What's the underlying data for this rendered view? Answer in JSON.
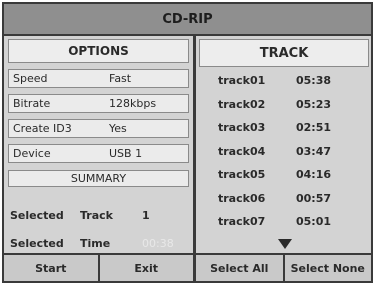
{
  "title": "CD-RIP",
  "options": {
    "header": "OPTIONS",
    "items": [
      {
        "label": "Speed",
        "value": "Fast"
      },
      {
        "label": "Bitrate",
        "value": "128kbps"
      },
      {
        "label": "Create ID3",
        "value": "Yes"
      },
      {
        "label": "Device",
        "value": "USB 1"
      }
    ]
  },
  "summary": {
    "header": "SUMMARY",
    "rows": [
      {
        "label": "Selected",
        "field": "Track",
        "value": "1"
      },
      {
        "label": "Selected",
        "field": "Time",
        "value": "00:38"
      }
    ]
  },
  "track_panel": {
    "header": "TRACK",
    "tracks": [
      {
        "name": "track01",
        "time": "05:38"
      },
      {
        "name": "track02",
        "time": "05:23"
      },
      {
        "name": "track03",
        "time": "02:51"
      },
      {
        "name": "track04",
        "time": "03:47"
      },
      {
        "name": "track05",
        "time": "04:16"
      },
      {
        "name": "track06",
        "time": "00:57"
      },
      {
        "name": "track07",
        "time": "05:01"
      }
    ]
  },
  "buttons": {
    "start": "Start",
    "exit": "Exit",
    "select_all": "Select All",
    "select_none": "Select None"
  },
  "icons": {
    "scroll_down": "down-triangle-icon"
  }
}
